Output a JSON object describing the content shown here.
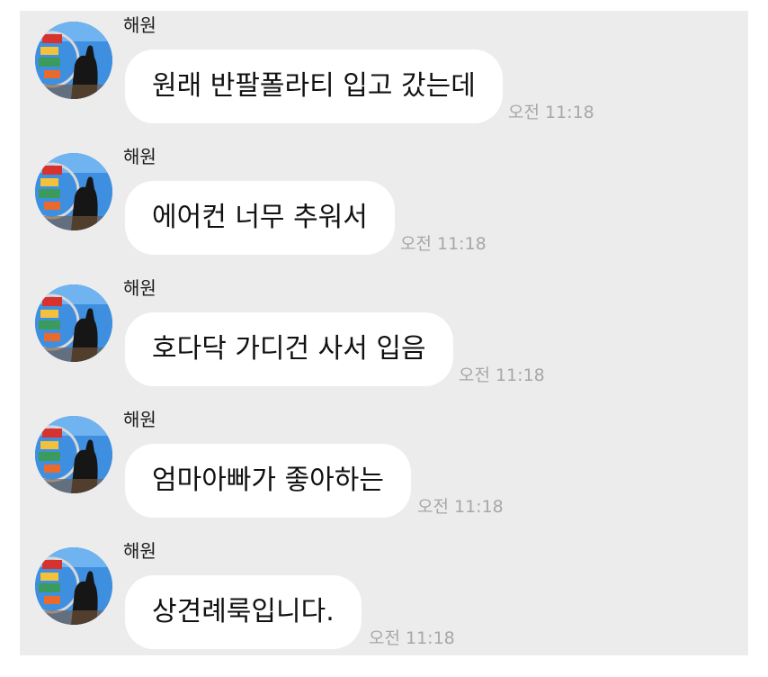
{
  "messages": [
    {
      "sender": "해원",
      "text": "원래 반팔폴라티 입고 갔는데",
      "time": "오전 11:18"
    },
    {
      "sender": "해원",
      "text": "에어컨 너무 추워서",
      "time": "오전 11:18"
    },
    {
      "sender": "해원",
      "text": "호다닥 가디건 사서 입음",
      "time": "오전 11:18"
    },
    {
      "sender": "해원",
      "text": "엄마아빠가 좋아하는",
      "time": "오전 11:18"
    },
    {
      "sender": "해원",
      "text": "상견례룩입니다.",
      "time": "오전 11:18"
    }
  ],
  "colors": {
    "chat_background": "#ececec",
    "bubble": "#ffffff",
    "timestamp": "#a7a7a7"
  },
  "icons": {
    "avatar": "profile-photo-avatar"
  }
}
